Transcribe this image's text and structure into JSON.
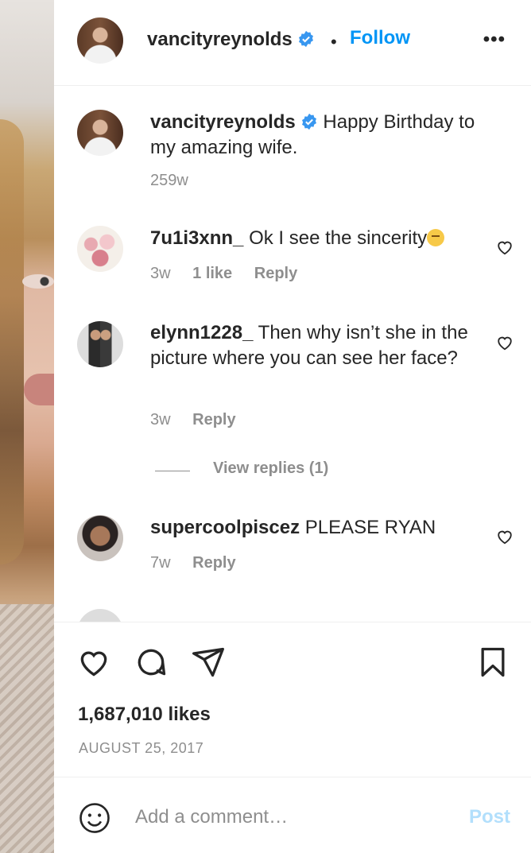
{
  "post_author": {
    "username": "vancityreynolds",
    "follow_label": "Follow",
    "separator": "•",
    "more_label": "•••"
  },
  "caption": {
    "username": "vancityreynolds",
    "text": "Happy Birthday to my amazing wife.",
    "time": "259w"
  },
  "comments": [
    {
      "username": "7u1i3xnn_",
      "text": "Ok I see the sincerity",
      "time": "3w",
      "likes": "1 like",
      "reply": "Reply"
    },
    {
      "username": "elynn1228_",
      "text": "Then why isn’t she in the picture where you can see her face?",
      "time": "3w",
      "reply": "Reply"
    },
    {
      "username": "supercoolpiscez",
      "text": "PLEASE RYAN",
      "time": "7w",
      "reply": "Reply"
    }
  ],
  "view_replies": "View replies (1)",
  "likes_count": "1,687,010 likes",
  "post_date": "AUGUST 25, 2017",
  "composer": {
    "placeholder": "Add a comment…",
    "post_label": "Post"
  },
  "colors": {
    "link": "#0095f6",
    "muted": "#8e8e8e",
    "post_disabled": "#b2dffc",
    "verified": "#3897f0"
  },
  "icons": [
    "verified-badge-icon",
    "more-options-icon",
    "heart-icon",
    "comment-icon",
    "share-icon",
    "bookmark-icon",
    "emoji-icon"
  ]
}
